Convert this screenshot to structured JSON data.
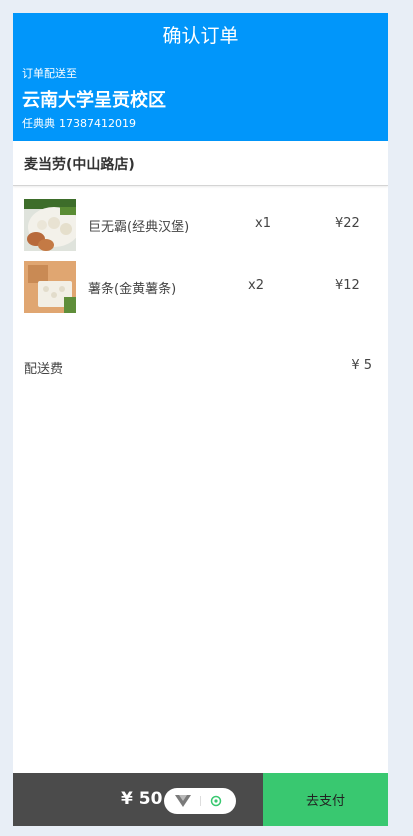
{
  "header": {
    "title": "确认订单",
    "deliver_to_label": "订单配送至",
    "address": "云南大学呈贡校区",
    "contact_name": "任典典",
    "contact_phone": "17387412019"
  },
  "shop": {
    "name": "麦当劳(中山路店)"
  },
  "items": [
    {
      "name": "巨无霸(经典汉堡)",
      "qty": "x1",
      "price": "¥22",
      "image": "burger-photo"
    },
    {
      "name": "薯条(金黄薯条)",
      "qty": "x2",
      "price": "¥12",
      "image": "fries-photo"
    }
  ],
  "delivery_fee": {
    "label": "配送费",
    "value": "¥ 5"
  },
  "footer": {
    "total": "¥ 50",
    "pay_label": "去支付"
  },
  "colors": {
    "header": "#0196fa",
    "pay": "#39c870",
    "footer_bar": "#4b4b4b"
  }
}
